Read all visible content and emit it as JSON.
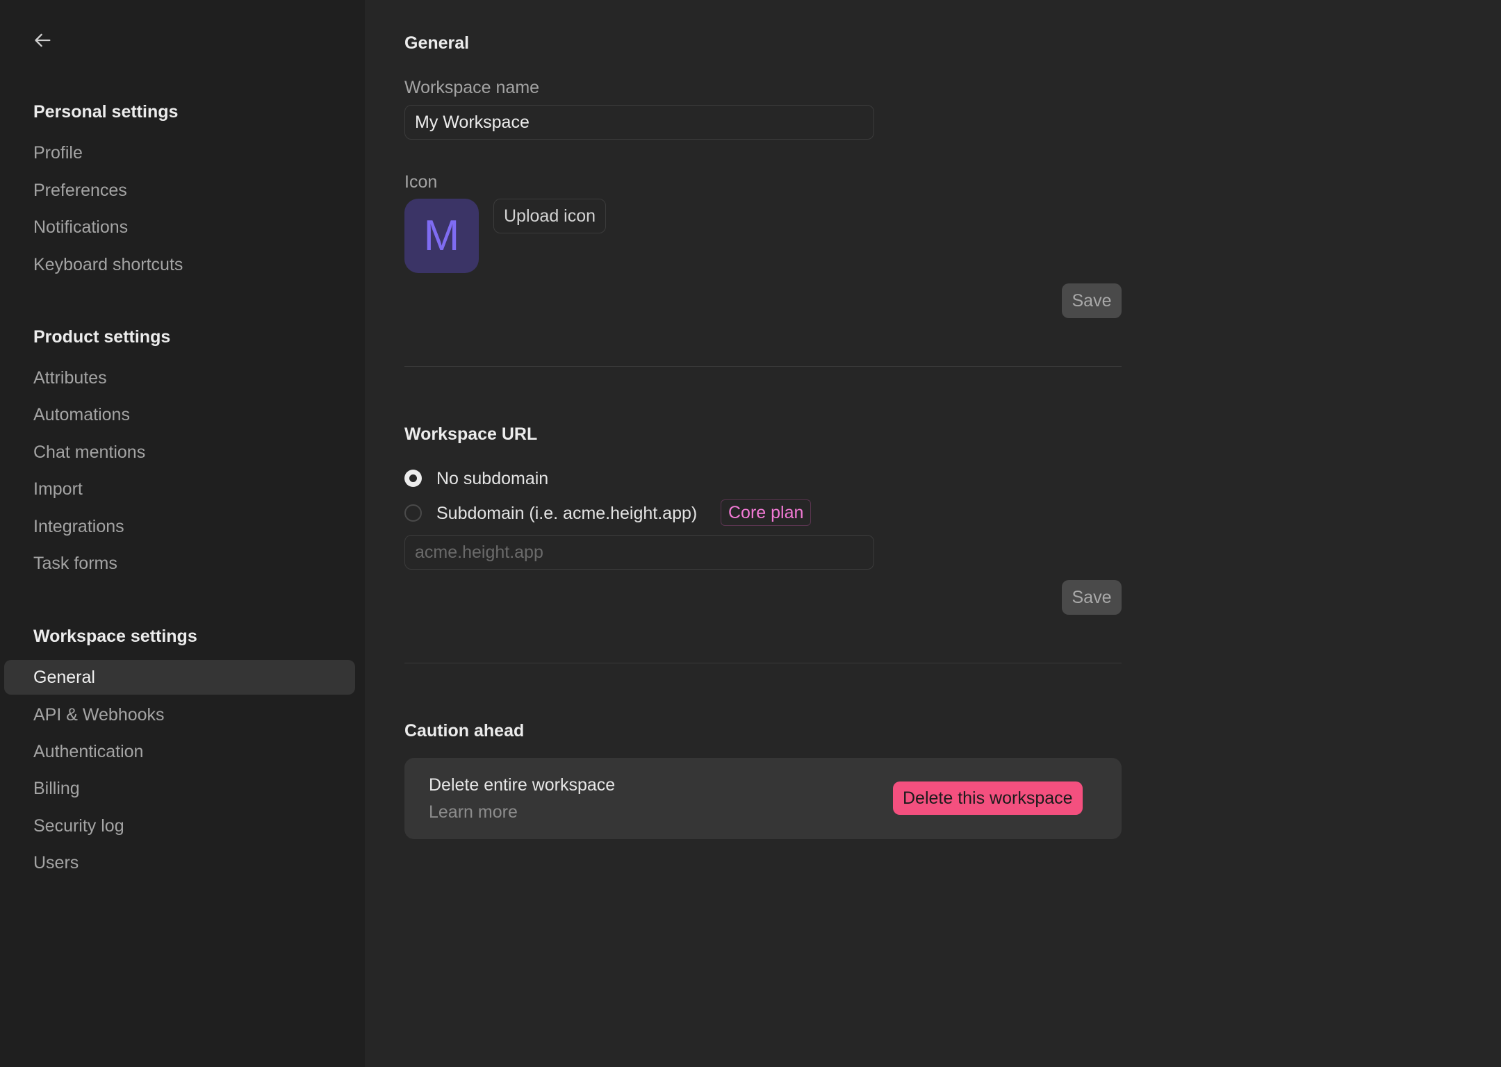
{
  "sidebar": {
    "back_icon": "arrow-left-icon",
    "sections": [
      {
        "heading": "Personal settings",
        "items": [
          "Profile",
          "Preferences",
          "Notifications",
          "Keyboard shortcuts"
        ]
      },
      {
        "heading": "Product settings",
        "items": [
          "Attributes",
          "Automations",
          "Chat mentions",
          "Import",
          "Integrations",
          "Task forms"
        ]
      },
      {
        "heading": "Workspace settings",
        "items": [
          "General",
          "API & Webhooks",
          "Authentication",
          "Billing",
          "Security log",
          "Users"
        ]
      }
    ],
    "active_item": "General"
  },
  "general": {
    "title": "General",
    "name_label": "Workspace name",
    "name_value": "My Workspace",
    "icon_label": "Icon",
    "icon_letter": "M",
    "upload_label": "Upload icon",
    "save_label": "Save"
  },
  "url": {
    "title": "Workspace URL",
    "option_none": "No subdomain",
    "option_sub": "Subdomain (i.e. acme.height.app)",
    "badge": "Core plan",
    "placeholder": "acme.height.app",
    "save_label": "Save",
    "selected": "none"
  },
  "caution": {
    "title": "Caution ahead",
    "card_title": "Delete entire workspace",
    "learn_more": "Learn more",
    "delete_label": "Delete this workspace"
  },
  "colors": {
    "background": "#262626",
    "sidebar": "#1f1f1f",
    "accent_icon": "#7f6cf2",
    "badge": "#f27ad5",
    "danger": "#f4507f"
  }
}
